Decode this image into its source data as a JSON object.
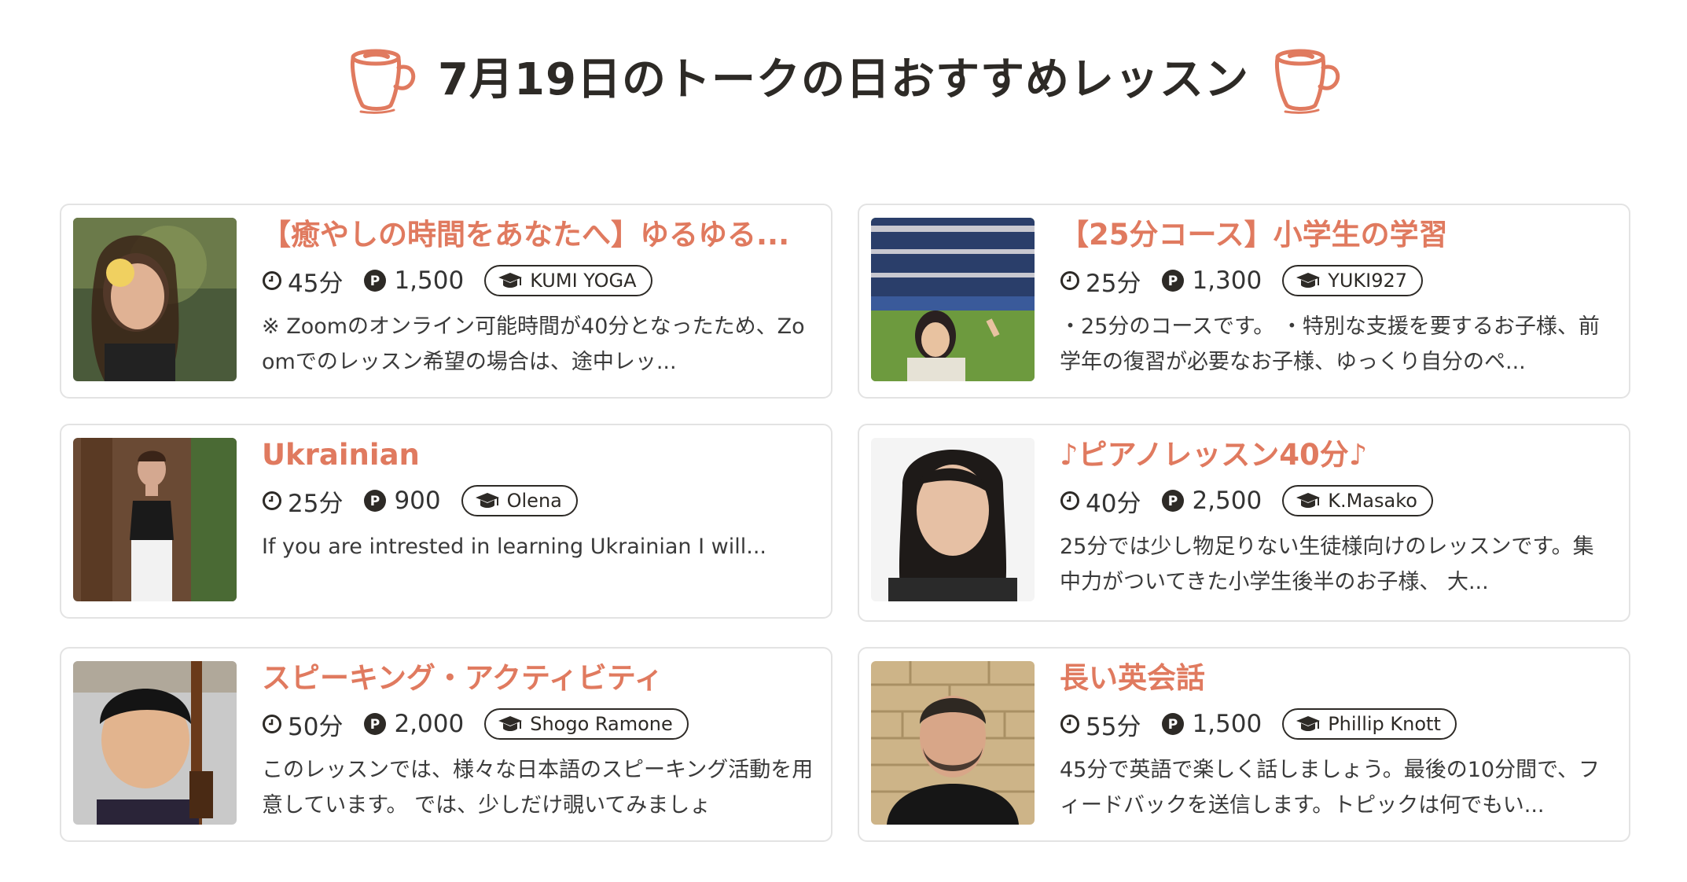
{
  "header": {
    "title": "7月19日のトークの日おすすめレッスン",
    "icon_left": "coffee-cup-icon",
    "icon_right": "coffee-cup-icon"
  },
  "colors": {
    "accent": "#e07a5f",
    "text": "#2d2a26",
    "border": "#e3e3e3"
  },
  "lessons": [
    {
      "title": "【癒やしの時間をあなたへ】ゆるゆる...",
      "duration": "45分",
      "points": "1,500",
      "teacher": "KUMI YOGA",
      "description": "※ Zoomのオンライン可能時間が40分となったため、Zoomでのレッスン希望の場合は、途中レッ..."
    },
    {
      "title": "【25分コース】小学生の学習",
      "duration": "25分",
      "points": "1,300",
      "teacher": "YUKI927",
      "description": "・25分のコースです。 ・特別な支援を要するお子様、前学年の復習が必要なお子様、ゆっくり自分のペ..."
    },
    {
      "title": "Ukrainian",
      "duration": "25分",
      "points": "900",
      "teacher": "Olena",
      "description": "If you are intrested in learning Ukrainian I will..."
    },
    {
      "title": "♪ピアノレッスン40分♪",
      "duration": "40分",
      "points": "2,500",
      "teacher": "K.Masako",
      "description": "25分では少し物足りない生徒様向けのレッスンです。集中力がついてきた小学生後半のお子様、 大..."
    },
    {
      "title": "スピーキング・アクティビティ",
      "duration": "50分",
      "points": "2,000",
      "teacher": "Shogo Ramone",
      "description": "このレッスンでは、様々な日本語のスピーキング活動を用意しています。 では、少しだけ覗いてみましょ"
    },
    {
      "title": "長い英会話",
      "duration": "55分",
      "points": "1,500",
      "teacher": "Phillip Knott",
      "description": "45分で英語で楽しく話しましょう。最後の10分間で、フィードバックを送信します。トピックは何でもい..."
    }
  ]
}
